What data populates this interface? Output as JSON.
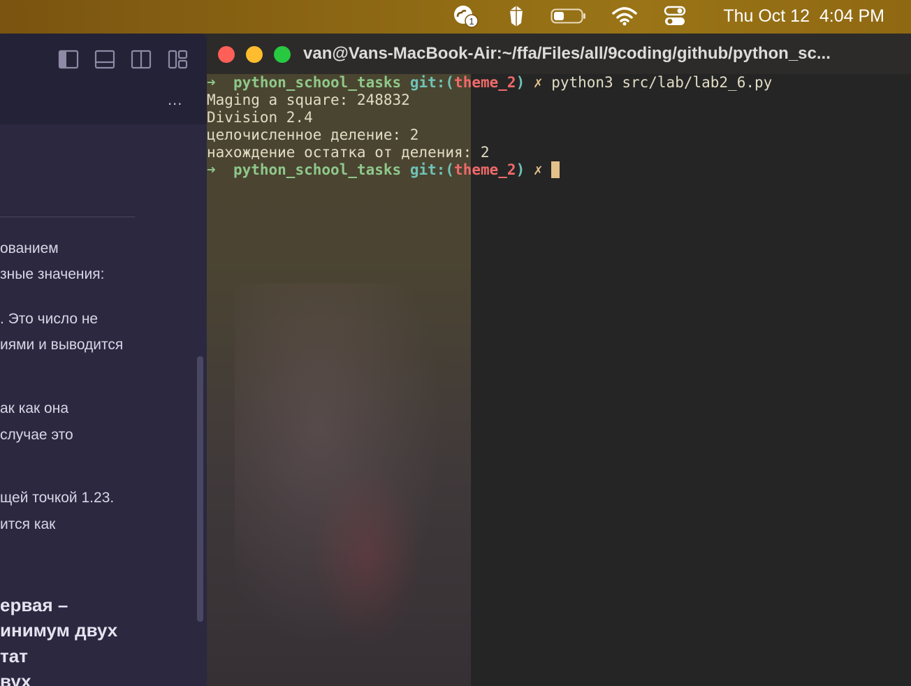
{
  "menubar": {
    "icons": [
      "cloud-badge-icon",
      "obsidian-crystal-icon",
      "battery-icon",
      "wifi-icon",
      "control-center-icon"
    ],
    "cloud_badge_count": "1",
    "date": "Thu Oct 12",
    "time": "4:04 PM"
  },
  "editor": {
    "more_label": "...",
    "lines": [
      "ованием",
      "зные значения:",
      ". Это число не",
      "иями и выводится",
      "ак как она",
      "случае это",
      "щей точкой 1.23.",
      "ится как"
    ],
    "bold_lines": [
      "ервая –",
      "инимум двух",
      "тат",
      "вух"
    ]
  },
  "terminal": {
    "title": "van@Vans-MacBook-Air:~/ffa/Files/all/9coding/github/python_sc...",
    "prompt": {
      "arrow": "➜",
      "repo": "python_school_tasks",
      "git_prefix": "git:(",
      "branch": "theme_2",
      "git_suffix": ")",
      "dirty": "✗"
    },
    "command": "python3 src/lab/lab2_6.py",
    "output": [
      "Maging a square: 248832",
      "Division 2.4",
      "целочисленное деление: 2",
      "нахождение остатка от деления: 2"
    ]
  },
  "colors": {
    "menubar_bg": "#8f6a14",
    "editor_bg": "#2b2840",
    "terminal_bg": "#252525",
    "prompt_green": "#8fc88a",
    "branch_red": "#f06a6a",
    "git_teal": "#6ec3b7",
    "cursor": "#e2c18a"
  }
}
